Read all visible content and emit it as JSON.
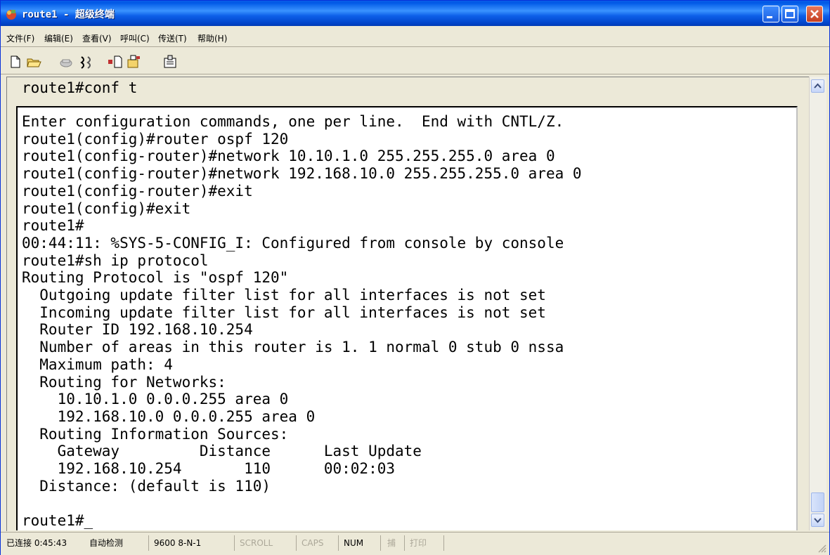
{
  "window": {
    "title": "route1 - 超级终端"
  },
  "menu": {
    "items": [
      "文件(F)",
      "编辑(E)",
      "查看(V)",
      "呼叫(C)",
      "传送(T)",
      "帮助(H)"
    ]
  },
  "toolbar": {
    "icons": [
      "new-icon",
      "open-icon",
      "call-icon",
      "disconnect-icon",
      "send-icon",
      "receive-icon",
      "properties-icon"
    ]
  },
  "terminal": {
    "top_line": "route1#conf t",
    "lines": [
      "Enter configuration commands, one per line.  End with CNTL/Z.",
      "route1(config)#router ospf 120",
      "route1(config-router)#network 10.10.1.0 255.255.255.0 area 0",
      "route1(config-router)#network 192.168.10.0 255.255.255.0 area 0",
      "route1(config-router)#exit",
      "route1(config)#exit",
      "route1#",
      "00:44:11: %SYS-5-CONFIG_I: Configured from console by console",
      "route1#sh ip protocol",
      "Routing Protocol is \"ospf 120\"",
      "  Outgoing update filter list for all interfaces is not set",
      "  Incoming update filter list for all interfaces is not set",
      "  Router ID 192.168.10.254",
      "  Number of areas in this router is 1. 1 normal 0 stub 0 nssa",
      "  Maximum path: 4",
      "  Routing for Networks:",
      "    10.10.1.0 0.0.0.255 area 0",
      "    192.168.10.0 0.0.0.255 area 0",
      "  Routing Information Sources:",
      "    Gateway         Distance      Last Update",
      "    192.168.10.254       110      00:02:03",
      "  Distance: (default is 110)",
      "",
      "route1#_"
    ]
  },
  "status": {
    "connected": "已连接 0:45:43",
    "detect": "自动检测",
    "port": "9600 8-N-1",
    "scroll": "SCROLL",
    "caps": "CAPS",
    "num": "NUM",
    "capture": "捕",
    "print": "打印"
  },
  "colors": {
    "titlebar": "#0058e6",
    "close_button": "#c43e1f",
    "terminal_bg": "#ffffff",
    "terminal_text": "#000000"
  }
}
